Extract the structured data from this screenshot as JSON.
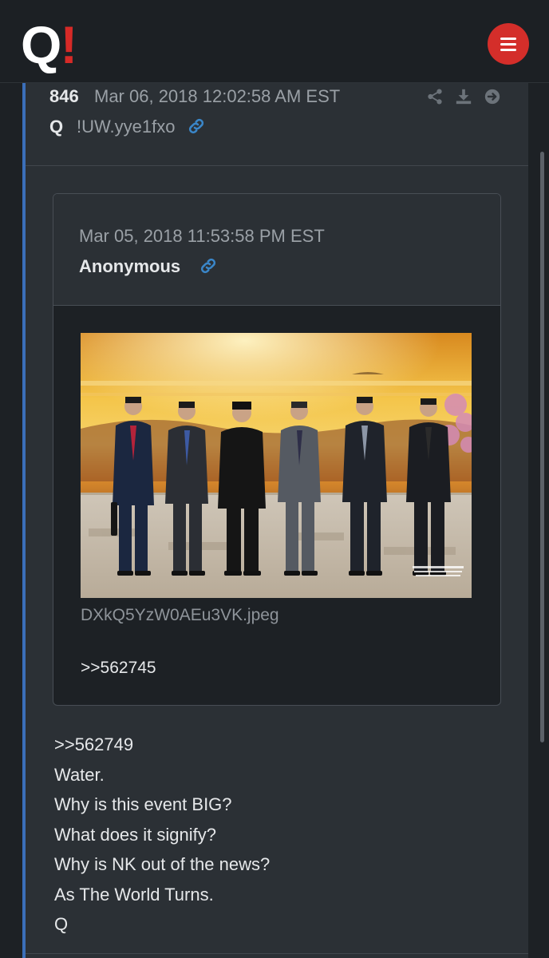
{
  "app": {
    "logo_letter": "Q",
    "logo_mark": "!"
  },
  "post": {
    "number": "846",
    "date": "Mar 06, 2018 12:02:58 AM EST",
    "author": "Q",
    "tripcode": "!UW.yye1fxo",
    "header_icons": [
      "share-icon",
      "download-icon",
      "arrow-right-circle-icon"
    ]
  },
  "quoted": {
    "date": "Mar 05, 2018 11:53:58 PM EST",
    "author": "Anonymous",
    "image_filename": "DXkQ5YzW0AEu3VK.jpeg",
    "reference": ">>562745"
  },
  "body": {
    "lines": [
      ">>562749",
      "Water.",
      "Why is this event BIG?",
      "What does it signify?",
      "Why is NK out of the news?",
      "As The World Turns.",
      "Q"
    ]
  },
  "colors": {
    "accent_red": "#d42e2a",
    "accent_blue": "#3b6fb9",
    "link_blue": "#3a86c8"
  }
}
